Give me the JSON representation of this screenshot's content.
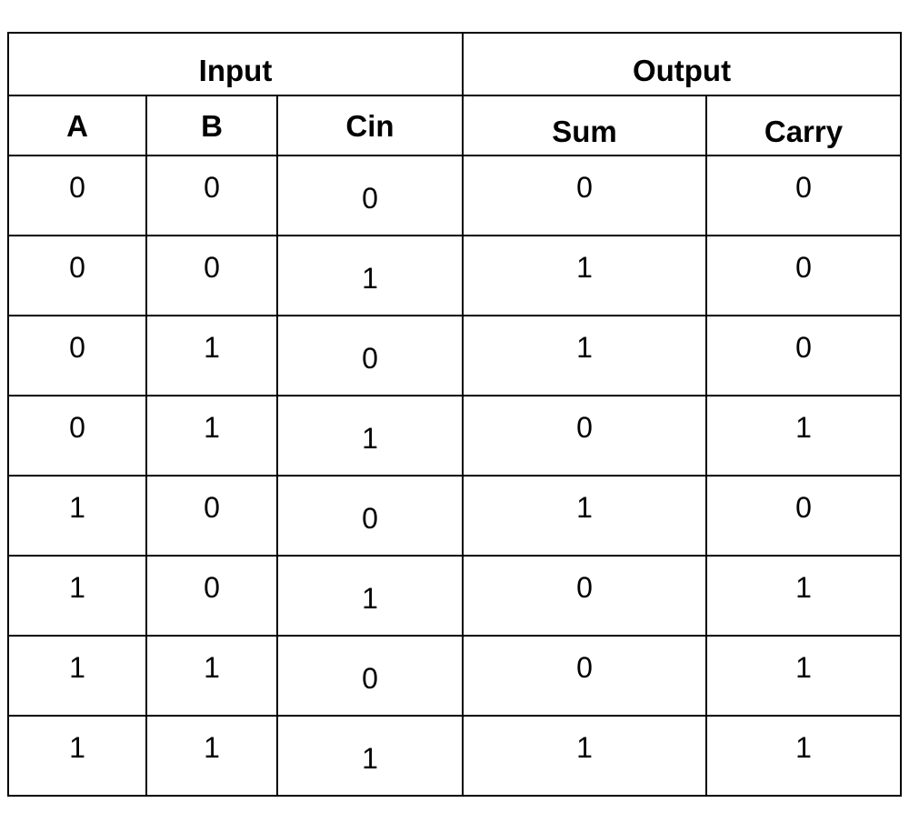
{
  "groups": [
    "Input",
    "Output"
  ],
  "columns": [
    "A",
    "B",
    "Cin",
    "Sum",
    "Carry"
  ],
  "rows": [
    [
      "0",
      "0",
      "0",
      "0",
      "0"
    ],
    [
      "0",
      "0",
      "1",
      "1",
      "0"
    ],
    [
      "0",
      "1",
      "0",
      "1",
      "0"
    ],
    [
      "0",
      "1",
      "1",
      "0",
      "1"
    ],
    [
      "1",
      "0",
      "0",
      "1",
      "0"
    ],
    [
      "1",
      "0",
      "1",
      "0",
      "1"
    ],
    [
      "1",
      "1",
      "0",
      "0",
      "1"
    ],
    [
      "1",
      "1",
      "1",
      "1",
      "1"
    ]
  ]
}
